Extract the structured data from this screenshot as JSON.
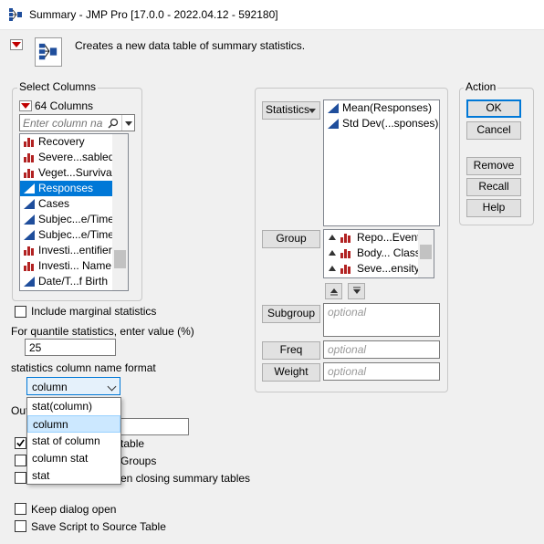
{
  "window": {
    "title": "Summary - JMP Pro [17.0.0 - 2022.04.12 - 592180]"
  },
  "header": {
    "description": "Creates a new data table of summary statistics."
  },
  "select_columns": {
    "title": "Select Columns",
    "count_label": "64 Columns",
    "search_placeholder": "Enter column na",
    "items": [
      {
        "label": "Recovery",
        "icon": "nominal-icon",
        "selected": false
      },
      {
        "label": "Severe...sabled",
        "icon": "nominal-icon",
        "selected": false
      },
      {
        "label": "Veget...Survival",
        "icon": "nominal-icon",
        "selected": false
      },
      {
        "label": "Responses",
        "icon": "continuous-icon",
        "selected": true
      },
      {
        "label": "Cases",
        "icon": "continuous-icon",
        "selected": false
      },
      {
        "label": "Subjec...e/Time",
        "icon": "continuous-icon",
        "selected": false
      },
      {
        "label": "Subjec...e/Time",
        "icon": "continuous-icon",
        "selected": false
      },
      {
        "label": "Investi...entifier",
        "icon": "nominal-icon",
        "selected": false
      },
      {
        "label": "Investi... Name",
        "icon": "nominal-icon",
        "selected": false
      },
      {
        "label": "Date/T...f Birth",
        "icon": "continuous-icon",
        "selected": false
      }
    ]
  },
  "options": {
    "marginal_label": "Include marginal statistics",
    "quantile_label": "For quantile statistics, enter value (%)",
    "quantile_value": "25",
    "name_format_label": "statistics column name format",
    "name_format_value": "column",
    "output_label_partial": "Out",
    "link_label_partial": "a table",
    "groups_label_partial": "Groups",
    "closing_label_partial": "en closing summary tables",
    "keep_open_label": "Keep dialog open",
    "save_script_label": "Save Script to Source Table"
  },
  "dropdown": {
    "items": [
      "stat(column)",
      "column",
      "stat of column",
      "column stat",
      "stat"
    ],
    "active_index": 1
  },
  "roles": {
    "statistics_button": "Statistics",
    "statistics_items": [
      "Mean(Responses)",
      "Std Dev(...sponses)"
    ],
    "group_button": "Group",
    "group_items": [
      "Repo...Event",
      "Body... Class",
      "Seve...ensity"
    ],
    "subgroup_button": "Subgroup",
    "freq_button": "Freq",
    "weight_button": "Weight",
    "optional_placeholder": "optional"
  },
  "action": {
    "title": "Action",
    "ok": "OK",
    "cancel": "Cancel",
    "remove": "Remove",
    "recall": "Recall",
    "help": "Help"
  }
}
